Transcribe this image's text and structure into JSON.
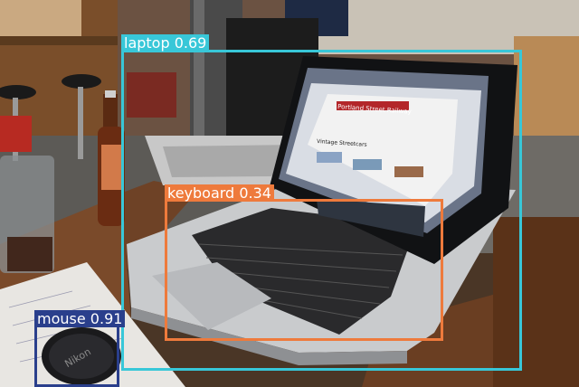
{
  "detections": [
    {
      "label": "laptop",
      "score": "0.69",
      "color": "#38c7d8"
    },
    {
      "label": "keyboard",
      "score": "0.34",
      "color": "#ee7a3c"
    },
    {
      "label": "mouse",
      "score": "0.91",
      "color": "#2a3f8c"
    }
  ],
  "screen": {
    "title": "Portland Street Railway",
    "heading": "Vintage Streetcars"
  },
  "lens_cap": {
    "brand": "Nikon"
  }
}
